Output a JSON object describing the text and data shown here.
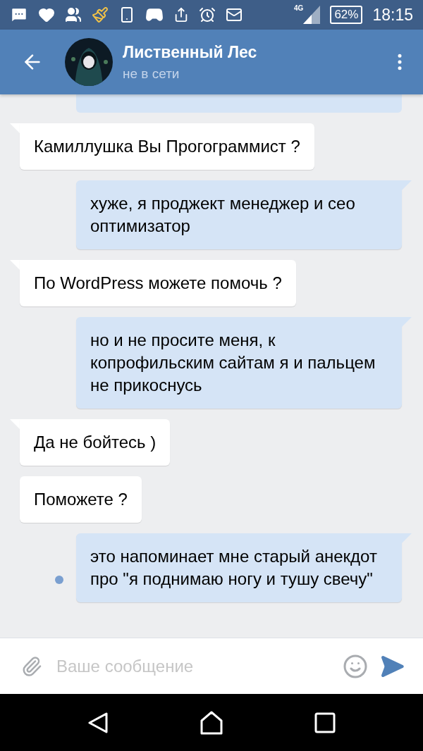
{
  "status_bar": {
    "network": "4G",
    "battery": "62%",
    "time": "18:15"
  },
  "header": {
    "name": "Лиственный Лес",
    "status": "не в сети"
  },
  "messages": [
    {
      "kind": "out",
      "cut": true
    },
    {
      "kind": "in",
      "text": "Камиллушка Вы Прогограммист ?",
      "tail": true
    },
    {
      "kind": "out",
      "text": "хуже, я проджект менеджер и сео оптимизатор",
      "tail": true,
      "unread": false
    },
    {
      "kind": "in",
      "text": "По WordPress можете помочь ?",
      "tail": true
    },
    {
      "kind": "out",
      "text": "но и не просите меня, к копрофильским сайтам я и пальцем не прикоснусь",
      "tail": true,
      "unread": false
    },
    {
      "kind": "in",
      "text": "Да не бойтесь )",
      "tail": true
    },
    {
      "kind": "in",
      "text": "Поможете ?",
      "tail": false
    },
    {
      "kind": "out",
      "text": "это напоминает мне старый анекдот про \"я поднимаю ногу и тушу свечу\"",
      "tail": true,
      "unread": true
    }
  ],
  "composer": {
    "placeholder": "Ваше сообщение"
  }
}
